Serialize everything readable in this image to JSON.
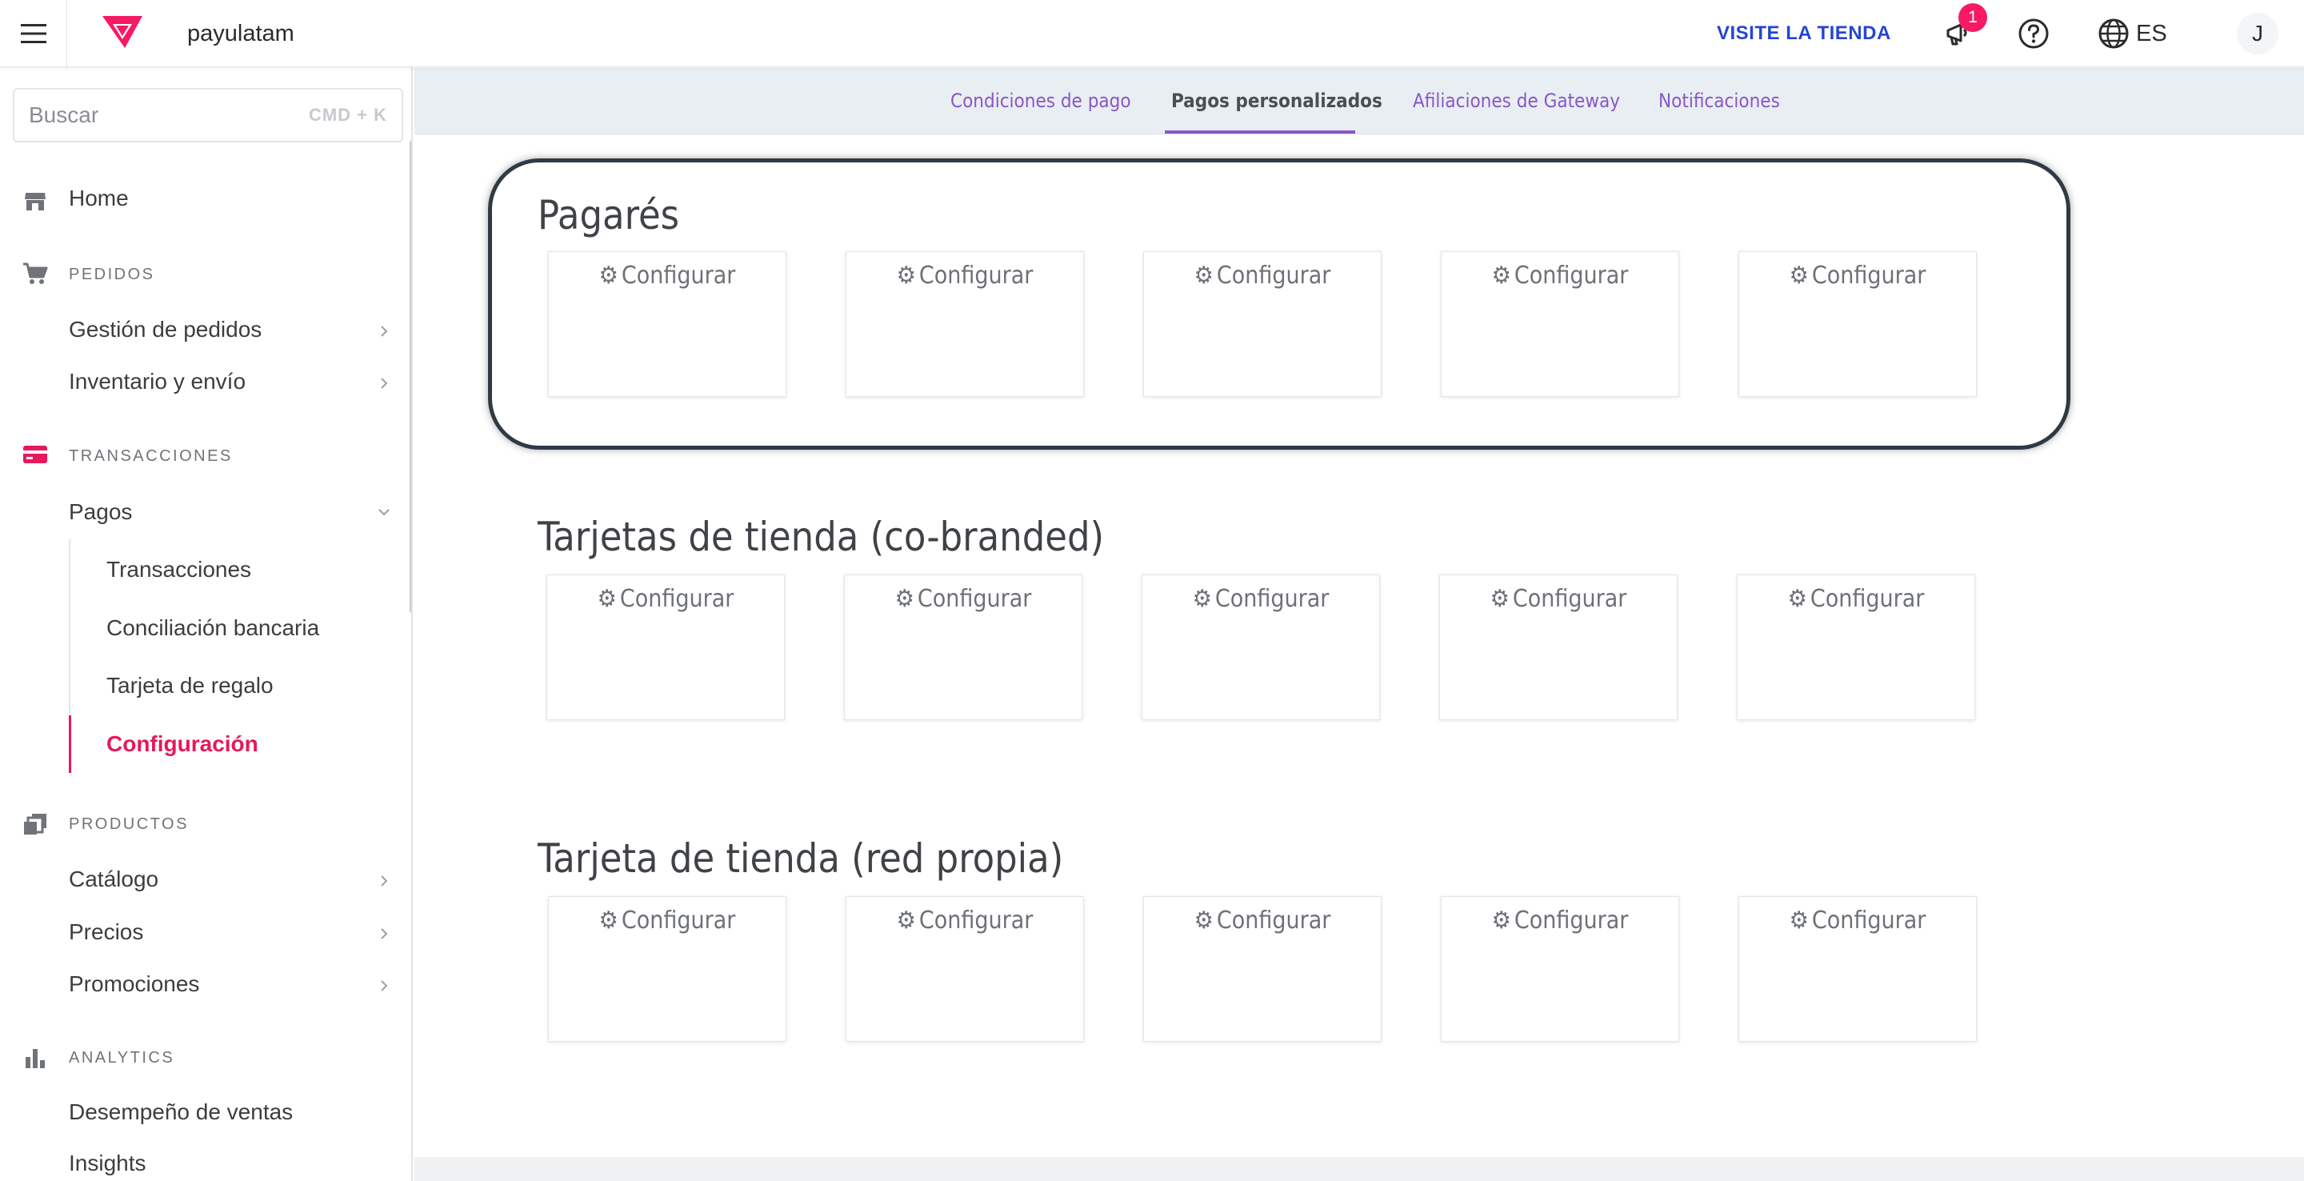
{
  "header": {
    "store_name": "payulatam",
    "visit_label": "VISITE LA TIENDA",
    "notification_count": "1",
    "language": "ES",
    "avatar_initial": "J",
    "accent_color": "#f71963"
  },
  "sidebar": {
    "search": {
      "placeholder": "Buscar",
      "shortcut": "CMD + K"
    },
    "home": "Home",
    "sections": {
      "pedidos": "PEDIDOS",
      "transacciones": "TRANSACCIONES",
      "productos": "PRODUCTOS",
      "analytics": "ANALYTICS"
    },
    "items": {
      "gestion_pedidos": "Gestión de pedidos",
      "inventario_envio": "Inventario y envío",
      "pagos": "Pagos",
      "transacciones": "Transacciones",
      "conciliacion": "Conciliación bancaria",
      "tarjeta_regalo": "Tarjeta de regalo",
      "configuracion": "Configuración",
      "catalogo": "Catálogo",
      "precios": "Precios",
      "promociones": "Promociones",
      "desempeno": "Desempeño de ventas",
      "insights": "Insights"
    },
    "icons": [
      "store-icon",
      "cart-icon",
      "card-icon",
      "products-icon",
      "chart-icon"
    ]
  },
  "tabs": [
    {
      "label": "Condiciones de pago",
      "active": false
    },
    {
      "label": "Pagos personalizados",
      "active": true
    },
    {
      "label": "Afiliaciones de Gateway",
      "active": false
    },
    {
      "label": "Notificaciones",
      "active": false
    }
  ],
  "sections": [
    {
      "title": "Pagarés",
      "cards": [
        "Configurar",
        "Configurar",
        "Configurar",
        "Configurar",
        "Configurar"
      ]
    },
    {
      "title": "Tarjetas de tienda (co-branded)",
      "cards": [
        "Configurar",
        "Configurar",
        "Configurar",
        "Configurar",
        "Configurar"
      ]
    },
    {
      "title": "Tarjeta de tienda (red propia)",
      "cards": [
        "Configurar",
        "Configurar",
        "Configurar",
        "Configurar",
        "Configurar"
      ]
    }
  ]
}
